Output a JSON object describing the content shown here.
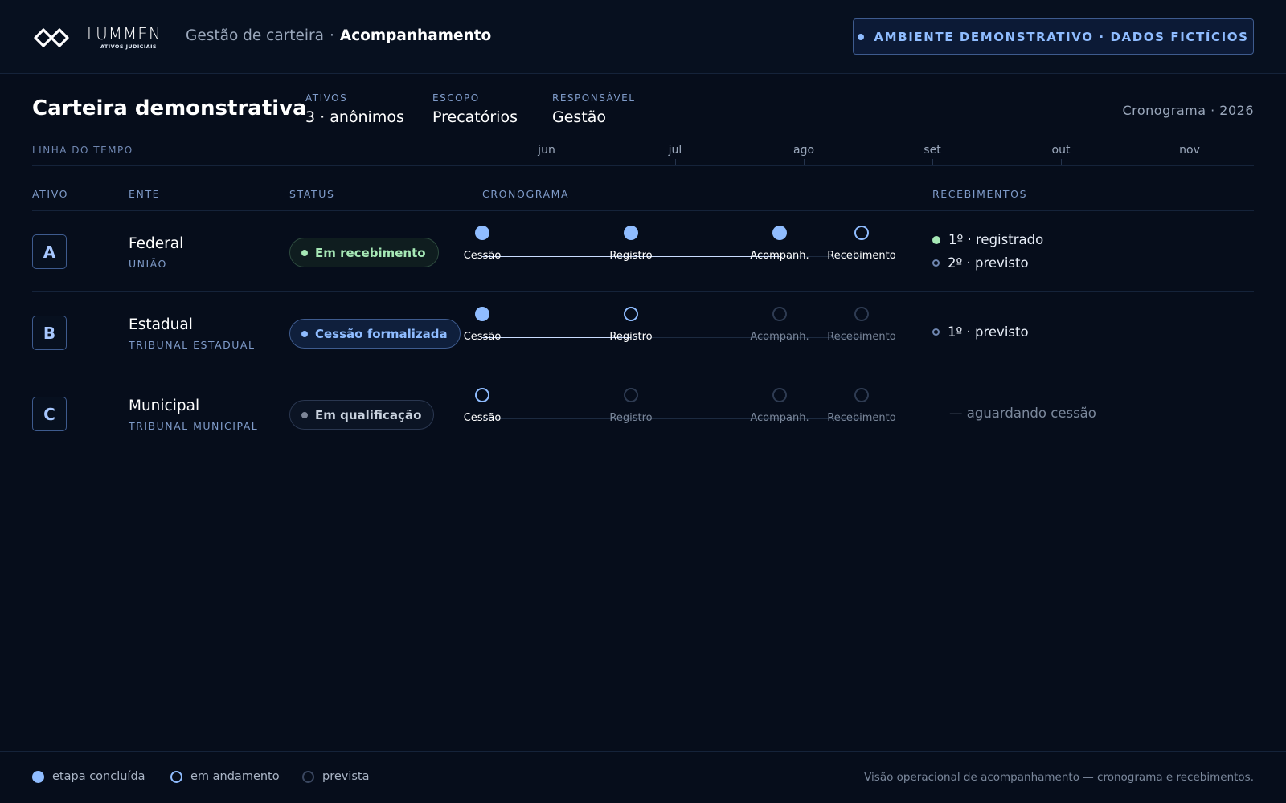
{
  "header": {
    "logo_word": "LUMMEN",
    "logo_sub": "ATIVOS JUDICIAIS",
    "breadcrumb": [
      "Gestão de carteira",
      "Acompanhamento"
    ],
    "breadcrumb_sep": "·",
    "demo_badge": "AMBIENTE DEMONSTRATIVO · DADOS FICTÍCIOS"
  },
  "summary": {
    "title": "Carteira demonstrativa",
    "meta": [
      {
        "key": "ATIVOS",
        "value": "3 · anônimos"
      },
      {
        "key": "ESCOPO",
        "value": "Precatórios"
      },
      {
        "key": "RESPONSÁVEL",
        "value": "Gestão"
      }
    ],
    "schedule_label": "Cronograma · 2026"
  },
  "timeline": {
    "label": "LINHA DO TEMPO",
    "months": [
      "jun",
      "jul",
      "ago",
      "set",
      "out",
      "nov"
    ]
  },
  "columns": {
    "ativo": "ATIVO",
    "ente": "ENTE",
    "status": "STATUS",
    "cronograma": "CRONOGRAMA",
    "recebimentos": "RECEBIMENTOS"
  },
  "stages": [
    "Cessão",
    "Registro",
    "Acompanh.",
    "Recebimento"
  ],
  "rows": [
    {
      "letter": "A",
      "ente": "Federal",
      "ente_sub": "UNIÃO",
      "status": "Em recebimento",
      "status_tone": "green",
      "stage_states": [
        "done",
        "done",
        "done",
        "progress"
      ],
      "receipts": [
        {
          "text": "1º · registrado",
          "state": "done"
        },
        {
          "text": "2º · previsto",
          "state": "planned"
        }
      ]
    },
    {
      "letter": "B",
      "ente": "Estadual",
      "ente_sub": "TRIBUNAL ESTADUAL",
      "status": "Cessão formalizada",
      "status_tone": "blue",
      "stage_states": [
        "done",
        "progress",
        "planned",
        "planned"
      ],
      "receipts": [
        {
          "text": "1º · previsto",
          "state": "planned"
        }
      ]
    },
    {
      "letter": "C",
      "ente": "Municipal",
      "ente_sub": "TRIBUNAL MUNICIPAL",
      "status": "Em qualificação",
      "status_tone": "gray",
      "stage_states": [
        "progress",
        "planned",
        "planned",
        "planned"
      ],
      "receipts_empty": "— aguardando cessão",
      "receipts": []
    }
  ],
  "legend": {
    "done": "etapa concluída",
    "progress": "em andamento",
    "planned": "prevista"
  },
  "footer_note": "Visão operacional de acompanhamento — cronograma e recebimentos.",
  "colors": {
    "background": "#060d1b",
    "accent": "#8fbcff",
    "success": "#a6e8b6",
    "muted": "#7a879b"
  }
}
